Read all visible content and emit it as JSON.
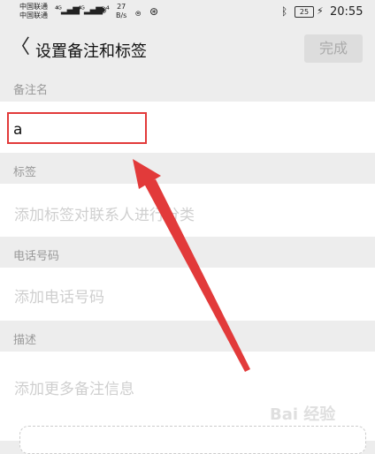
{
  "status_bar": {
    "carrier_1": "中国联通",
    "carrier_2": "中国联通",
    "speed_value": "27",
    "speed_unit": "B/s",
    "battery": "25",
    "time": "20:55"
  },
  "header": {
    "title": "设置备注和标签",
    "done_label": "完成"
  },
  "remark": {
    "label": "备注名",
    "value": "a"
  },
  "tags": {
    "label": "标签",
    "placeholder": "添加标签对联系人进行分类"
  },
  "phone": {
    "label": "电话号码",
    "placeholder": "添加电话号码"
  },
  "description": {
    "label": "描述",
    "placeholder": "添加更多备注信息"
  },
  "colors": {
    "annotation_red": "#e23a3a"
  },
  "watermark": "Bai 经验"
}
